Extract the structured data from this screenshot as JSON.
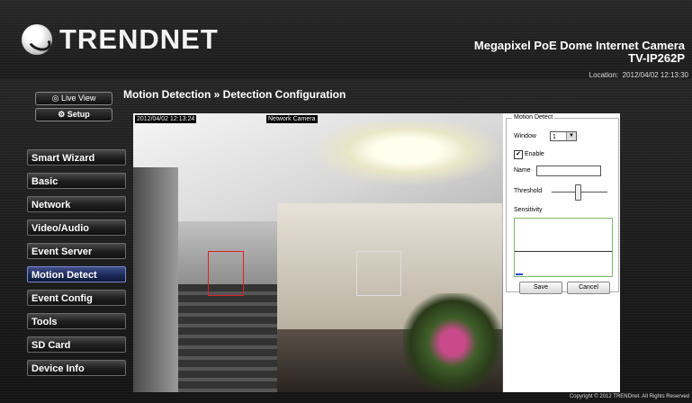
{
  "brand": {
    "logo_text": "TRENDNET",
    "product_line1": "Megapixel PoE Dome Internet Camera",
    "product_line2": "TV-IP262P"
  },
  "location": {
    "label": "Location:",
    "datetime": "2012/04/02 12:13:30"
  },
  "view_buttons": {
    "live_view": "Live View",
    "setup": "Setup"
  },
  "sidebar": {
    "items": [
      {
        "label": "Smart Wizard",
        "active": false
      },
      {
        "label": "Basic",
        "active": false
      },
      {
        "label": "Network",
        "active": false
      },
      {
        "label": "Video/Audio",
        "active": false
      },
      {
        "label": "Event Server",
        "active": false
      },
      {
        "label": "Motion Detect",
        "active": true
      },
      {
        "label": "Event Config",
        "active": false
      },
      {
        "label": "Tools",
        "active": false
      },
      {
        "label": "SD Card",
        "active": false
      },
      {
        "label": "Device Info",
        "active": false
      }
    ]
  },
  "page": {
    "title": "Motion Detection » Detection Configuration"
  },
  "video": {
    "timestamp": "2012/04/02 12:13:24",
    "camera_name": "Network Camera",
    "zone_colors": [
      "#e02020",
      "#dedede"
    ]
  },
  "motion_form": {
    "legend": "Motion Detect",
    "window_label": "Window",
    "window_value": "1",
    "enable_label": "Enable",
    "enable_checked_glyph": "✔",
    "name_label": "Name",
    "name_value": "",
    "threshold_label": "Threshold",
    "sensitivity_label": "Sensitivity",
    "save_label": "Save",
    "cancel_label": "Cancel"
  },
  "footer": {
    "copyright": "Copyright © 2012 TRENDnet. All Rights Reserved"
  }
}
